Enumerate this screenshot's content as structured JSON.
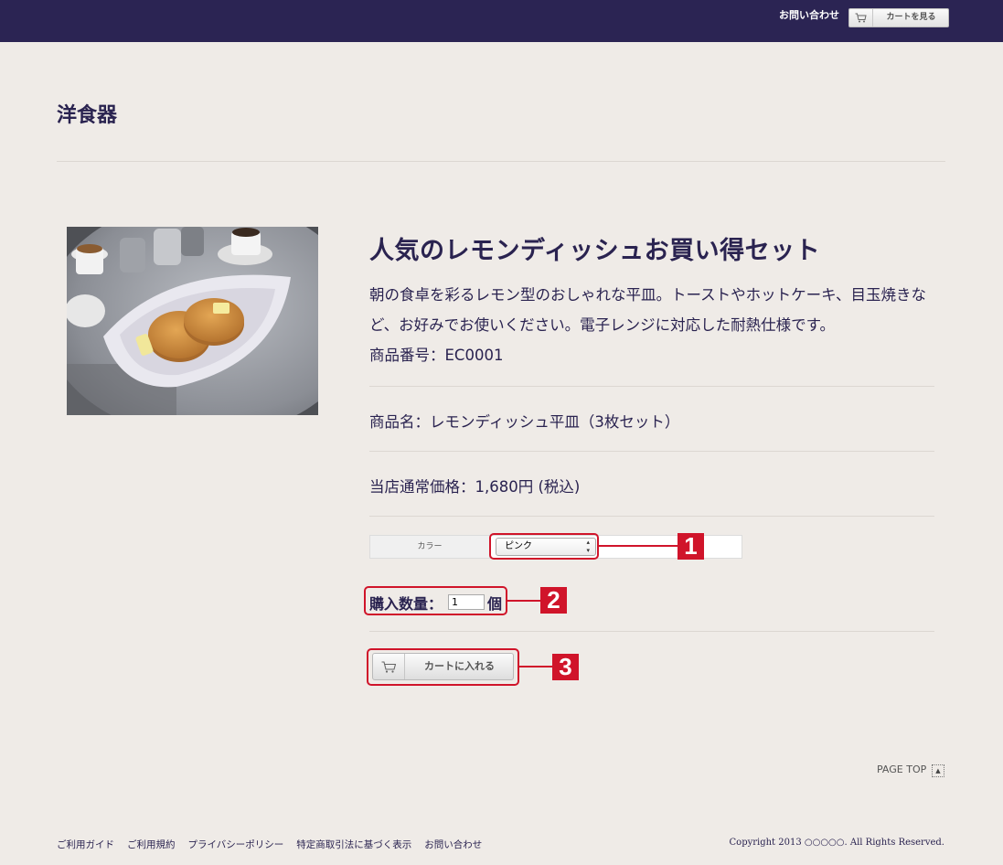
{
  "header": {
    "contact_label": "お問い合わせ",
    "cart_view_label": "カートを見る",
    "cart_icon": "cart-icon",
    "bg_color": "#2b2453"
  },
  "category": {
    "title": "洋食器"
  },
  "product": {
    "image_alt": "pancakes-on-lemon-dish-photo",
    "title": "人気のレモンディッシュお買い得セット",
    "description": "朝の食卓を彩るレモン型のおしゃれな平皿。トーストやホットケーキ、目玉焼きなど、お好みでお使いください。電子レンジに対応した耐熱仕様です。",
    "code": "商品番号：EC0001",
    "name": "商品名：レモンディッシュ平皿（3枚セット）",
    "price": "当店通常価格：1,680円 (税込)"
  },
  "options": {
    "color_label": "カラー",
    "color_selected": "ピンク"
  },
  "quantity": {
    "label": "購入数量：",
    "value": "1",
    "unit": "個"
  },
  "add_to_cart": {
    "label": "カートに入れる",
    "icon": "cart-icon"
  },
  "callouts": [
    "1",
    "2",
    "3"
  ],
  "page_top": {
    "label": "PAGE TOP",
    "icon": "arrow-up-icon"
  },
  "footer": {
    "links": [
      "ご利用ガイド",
      "ご利用規約",
      "プライバシーポリシー",
      "特定商取引法に基づく表示",
      "お問い合わせ"
    ],
    "copyright": "Copyright 2013 ○○○○○. All Rights Reserved."
  },
  "colors": {
    "accent": "#2a2350",
    "callout": "#d0142a",
    "background": "#efebe7"
  }
}
